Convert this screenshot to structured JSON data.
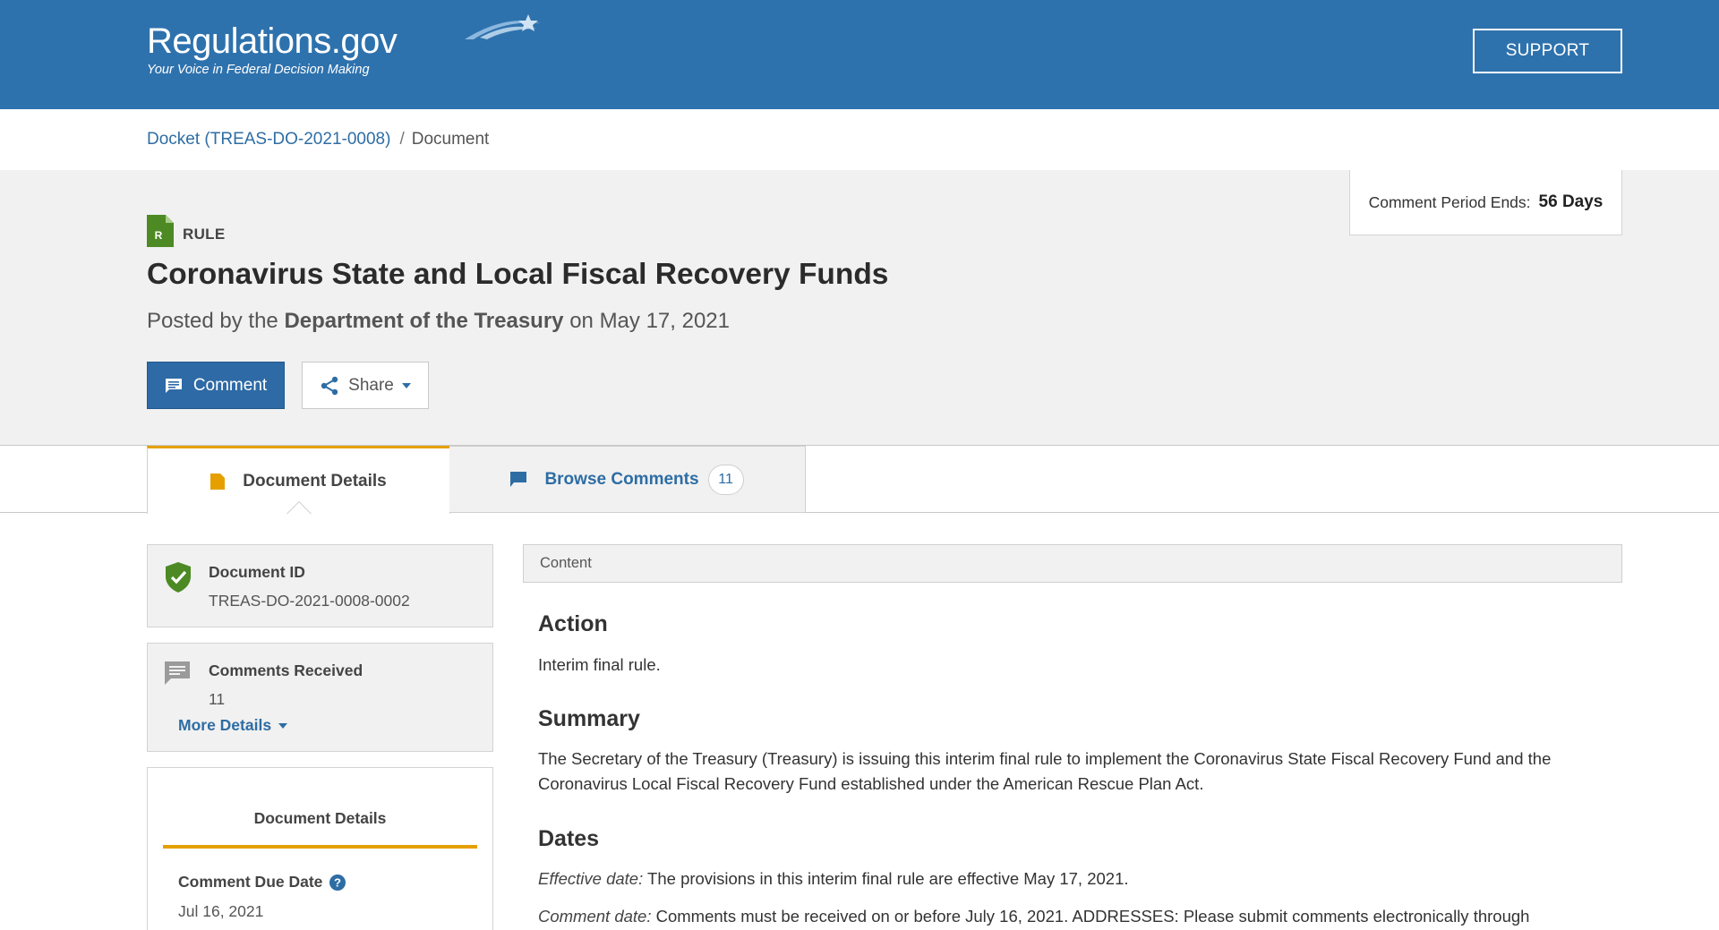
{
  "header": {
    "logo": "Regulations.gov",
    "tagline": "Your Voice in Federal Decision Making",
    "support": "SUPPORT"
  },
  "breadcrumb": {
    "docket": "Docket (TREAS-DO-2021-0008)",
    "separator": "/",
    "current": "Document"
  },
  "comment_period": {
    "label": "Comment Period Ends:",
    "value": "56 Days"
  },
  "document": {
    "type_letter": "R",
    "type": "RULE",
    "title": "Coronavirus State and Local Fiscal Recovery Funds",
    "posted_prefix": "Posted by the",
    "agency": "Department of the Treasury",
    "posted_on": "on May 17, 2021"
  },
  "actions": {
    "comment": "Comment",
    "share": "Share"
  },
  "tabs": {
    "details": "Document Details",
    "browse": "Browse Comments",
    "browse_count": "11"
  },
  "sidebar": {
    "doc_id_label": "Document ID",
    "doc_id": "TREAS-DO-2021-0008-0002",
    "comments_label": "Comments Received",
    "comments_count": "11",
    "more_details": "More Details",
    "details_heading": "Document Details",
    "due_label": "Comment Due Date",
    "due_value": "Jul 16, 2021"
  },
  "content": {
    "bar": "Content",
    "action_h": "Action",
    "action_p": "Interim final rule.",
    "summary_h": "Summary",
    "summary_p": "The Secretary of the Treasury (Treasury) is issuing this interim final rule to implement the Coronavirus State Fiscal Recovery Fund and the Coronavirus Local Fiscal Recovery Fund established under the American Rescue Plan Act.",
    "dates_h": "Dates",
    "eff_label": "Effective date:",
    "eff_text": "The provisions in this interim final rule are effective May 17, 2021.",
    "cd_label": "Comment date:",
    "cd_text": "Comments must be received on or before July 16, 2021. ADDRESSES: Please submit comments electronically through"
  },
  "colors": {
    "header": "#2e72ad",
    "primary": "#2e6aa5",
    "accent": "#e5a000",
    "rule_green": "#4d8a24",
    "hero_bg": "#f1f1f1"
  },
  "icons": [
    "logo-swoosh-icon",
    "rule-doc-icon",
    "comment-icon",
    "share-icon",
    "caret-down-icon",
    "document-icon",
    "comment-bubble-icon",
    "shield-check-icon",
    "comments-icon",
    "help-icon"
  ]
}
